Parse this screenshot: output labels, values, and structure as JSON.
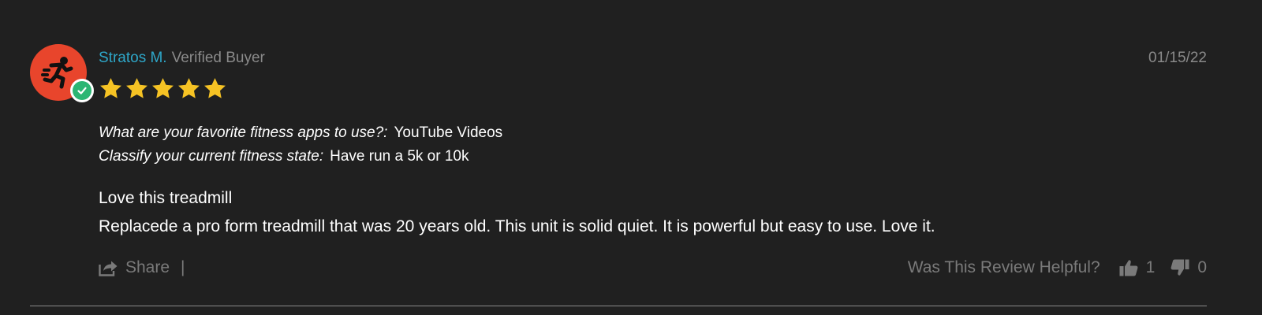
{
  "review": {
    "author": "Stratos M.",
    "author_badge": "Verified Buyer",
    "date": "01/15/22",
    "rating": 5,
    "rating_max": 5,
    "questions": [
      {
        "question": "What are your favorite fitness apps to use?:",
        "answer": "YouTube Videos"
      },
      {
        "question": "Classify your current fitness state:",
        "answer": "Have run a 5k or 10k"
      }
    ],
    "title": "Love this treadmill",
    "body": "Replacede a pro form treadmill that was 20 years old. This unit is solid quiet. It is powerful but easy to use. Love it."
  },
  "footer": {
    "share_label": "Share",
    "separator": "|",
    "helpful_label": "Was This Review Helpful?",
    "upvotes": "1",
    "downvotes": "0"
  },
  "icons": {
    "avatar": "runner-icon",
    "verified": "check-circle-icon",
    "star": "star-icon",
    "share": "share-icon",
    "thumbs_up": "thumbs-up-icon",
    "thumbs_down": "thumbs-down-icon"
  },
  "colors": {
    "background": "#202020",
    "author": "#2ea7c9",
    "muted": "#8a8a8a",
    "avatar_bg": "#e8452c",
    "verified_green": "#2bb673",
    "star_yellow": "#f6c324"
  }
}
